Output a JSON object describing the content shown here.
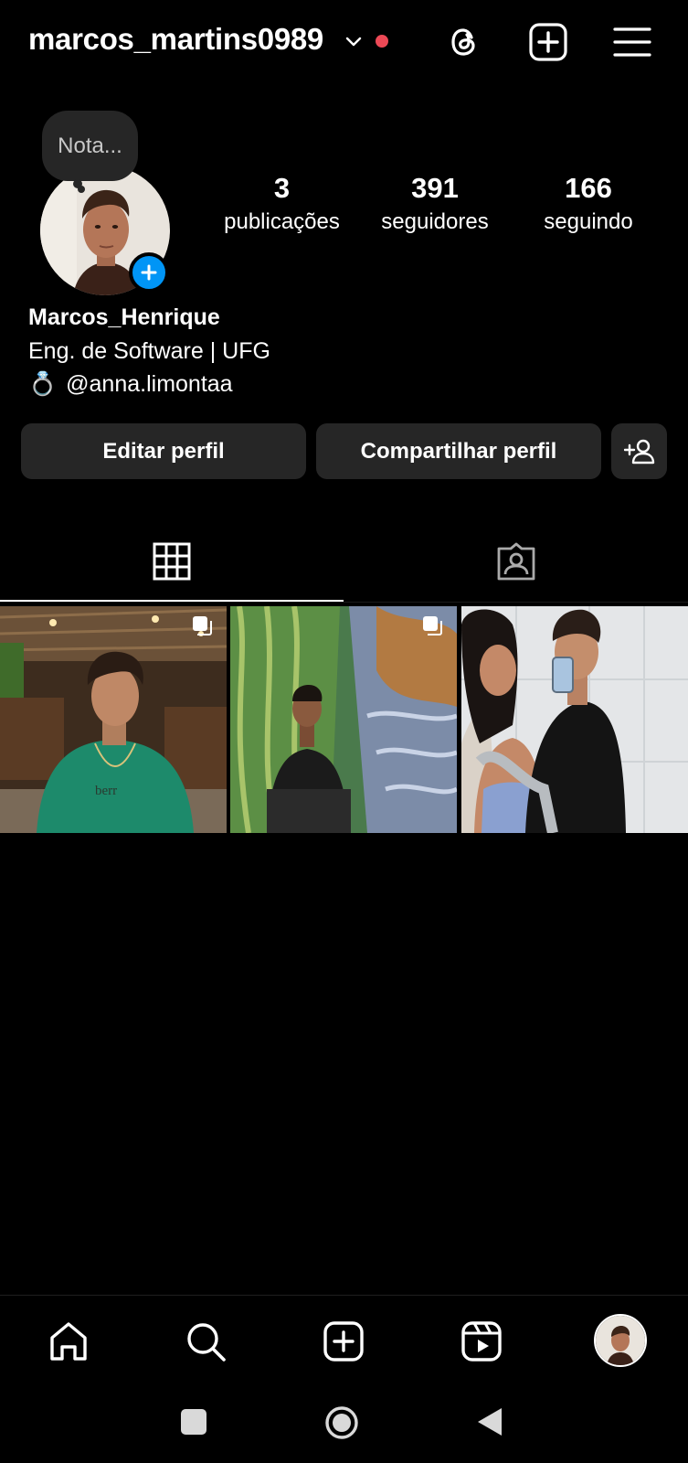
{
  "header": {
    "username": "marcos_martins0989",
    "icons": [
      "chevron-down-icon",
      "threads-icon",
      "create-post-icon",
      "menu-icon"
    ],
    "notification_color": "#ed4956"
  },
  "note": {
    "placeholder": "Nota..."
  },
  "profile": {
    "stats": [
      {
        "value": "3",
        "label": "publicações"
      },
      {
        "value": "391",
        "label": "seguidores"
      },
      {
        "value": "166",
        "label": "seguindo"
      }
    ],
    "name": "Marcos_Henrique",
    "bio": "Eng. de Software | UFG",
    "link_emoji": "💍",
    "link": "@anna.limontaa"
  },
  "actions": {
    "edit": "Editar perfil",
    "share": "Compartilhar perfil",
    "discover_icon": "add-person-icon"
  },
  "tabs": [
    {
      "icon": "grid-icon",
      "active": true
    },
    {
      "icon": "tagged-icon",
      "active": false
    }
  ],
  "posts": [
    {
      "description": "photo-restaurant",
      "multiple": true
    },
    {
      "description": "photo-painting-mural",
      "multiple": true
    },
    {
      "description": "photo-couple-mirror",
      "multiple": false
    }
  ],
  "bottom_nav": [
    "home-icon",
    "search-icon",
    "create-icon",
    "reels-icon",
    "profile-avatar"
  ],
  "system_nav": [
    "recents-icon",
    "home-circle-icon",
    "back-icon"
  ],
  "colors": {
    "accent": "#0095f6",
    "button_bg": "#262626",
    "background": "#000000"
  }
}
